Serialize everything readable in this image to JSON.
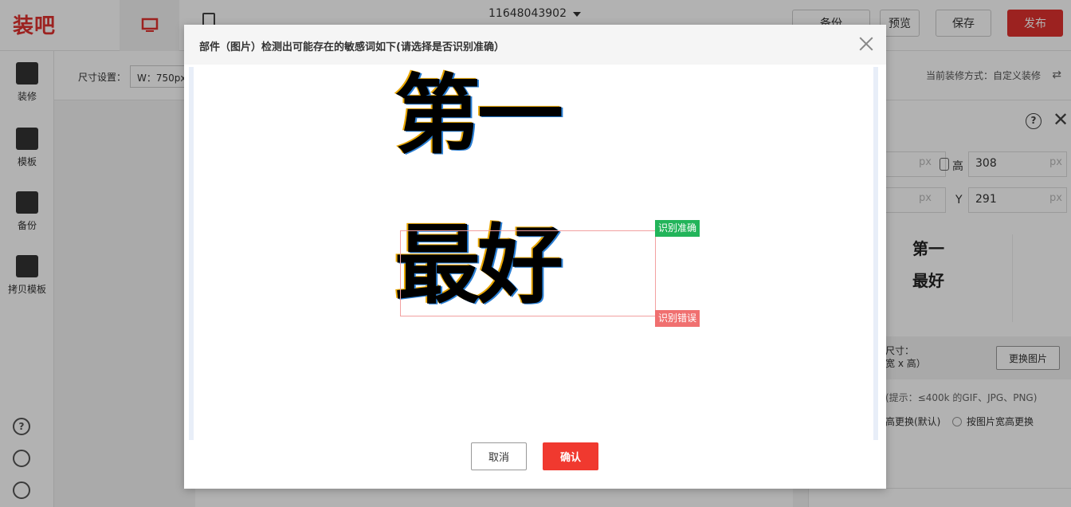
{
  "app": {
    "logo": "装吧",
    "shop_id": "11648043902",
    "buttons": {
      "backup": "备份",
      "preview": "预览",
      "save": "保存",
      "publish": "发布"
    }
  },
  "left_nav": {
    "items": [
      {
        "label": "装修",
        "icon": "paint-roller-icon"
      },
      {
        "label": "模板",
        "icon": "shirt-icon"
      },
      {
        "label": "备份",
        "icon": "backup-icon"
      },
      {
        "label": "拷贝模板",
        "icon": "copy-template-icon"
      }
    ],
    "footer_icons": [
      "help-icon",
      "headset-icon",
      "feedback-icon"
    ]
  },
  "subbar": {
    "size_label": "尺寸设置：",
    "size_value": "W：750px",
    "mode_text": "当前装修方式：自定义装修"
  },
  "right_panel": {
    "unit": "px",
    "height_label": "高",
    "height_value": "308",
    "y_label": "Y",
    "y_value": "291",
    "preview_line1": "第一",
    "preview_line2": "最好",
    "size_label": "尺寸：",
    "size_sub": "宽 x 高）",
    "change_image": "更换图片",
    "hint": "(提示：≤400k 的GIF、JPG、PNG)",
    "radio1": "高更换(默认)",
    "radio2": "按图片宽高更换"
  },
  "modal": {
    "title": "部件（图片）检测出可能存在的敏感词如下(请选择是否识别准确）",
    "line1": "第一",
    "line2": "最好",
    "tag_correct": "识别准确",
    "tag_wrong": "识别错误",
    "cancel": "取消",
    "confirm": "确认"
  },
  "colors": {
    "brand": "#e0312e",
    "confirm": "#f0392f",
    "tag_correct": "#22b45a",
    "tag_wrong": "#f07070"
  }
}
